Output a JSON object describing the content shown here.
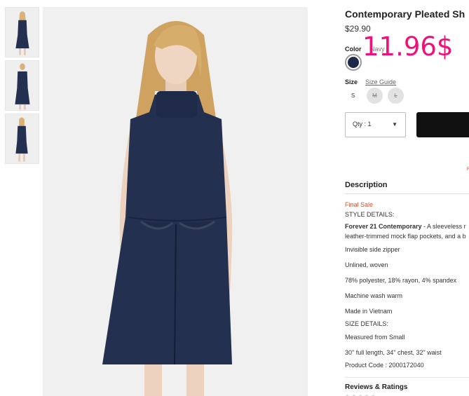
{
  "product": {
    "title": "Contemporary Pleated Sh",
    "price": "$29.90",
    "price_overlay": "11.96$",
    "color_label": "Color",
    "color_value": "Navy",
    "swatch_color": "#1f2a48",
    "size_label": "Size",
    "size_guide": "Size Guide",
    "sizes": [
      "S",
      "M",
      "L"
    ],
    "quantity": "Qty : 1"
  },
  "description": {
    "heading": "Description",
    "final_sale": "Final Sale",
    "lines": [
      "STYLE DETAILS:",
      "Forever 21 Contemporary",
      " - A sleeveless r",
      "leather-trimmed mock flap pockets, and a b",
      "Invisible side zipper",
      "Unlined, woven",
      "78% polyester, 18% rayon, 4% spandex",
      "Machine wash warm",
      "Made in Vietnam",
      "SIZE DETAILS:",
      "Measured from Small",
      "30\" full length, 34\" chest, 32\" waist",
      "Product Code : 2000172040"
    ]
  },
  "reviews": {
    "heading": "Reviews & Ratings"
  },
  "colors": {
    "accent_overlay": "#ee117a",
    "final_sale": "#c0573a",
    "dress": "#24304f"
  }
}
